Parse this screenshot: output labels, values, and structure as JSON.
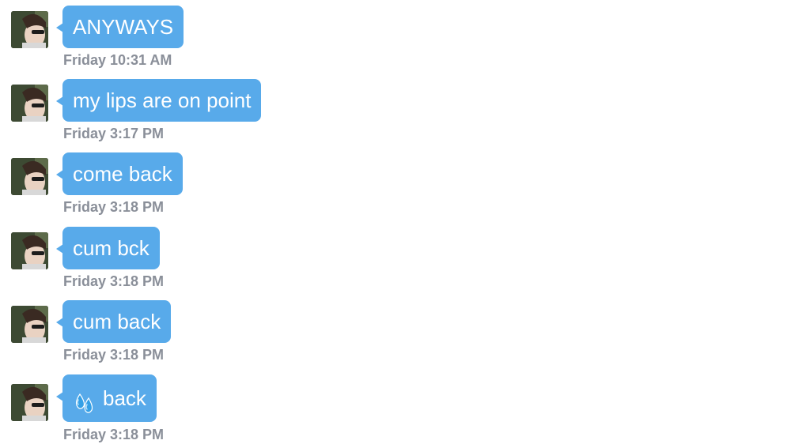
{
  "colors": {
    "bubble": "#58aaea",
    "bubble_text": "#ffffff",
    "timestamp": "#8a8f99",
    "background": "#ffffff"
  },
  "messages": [
    {
      "text": "ANYWAYS",
      "time": "Friday 10:31 AM"
    },
    {
      "text": "my lips are on point",
      "time": "Friday 3:17 PM"
    },
    {
      "text": "come back",
      "time": "Friday 3:18 PM"
    },
    {
      "text": "cum bck",
      "time": "Friday 3:18 PM"
    },
    {
      "text": "cum back",
      "time": "Friday 3:18 PM"
    },
    {
      "text": "back",
      "icon": "sweat-droplets-icon",
      "time": "Friday 3:18 PM"
    }
  ]
}
